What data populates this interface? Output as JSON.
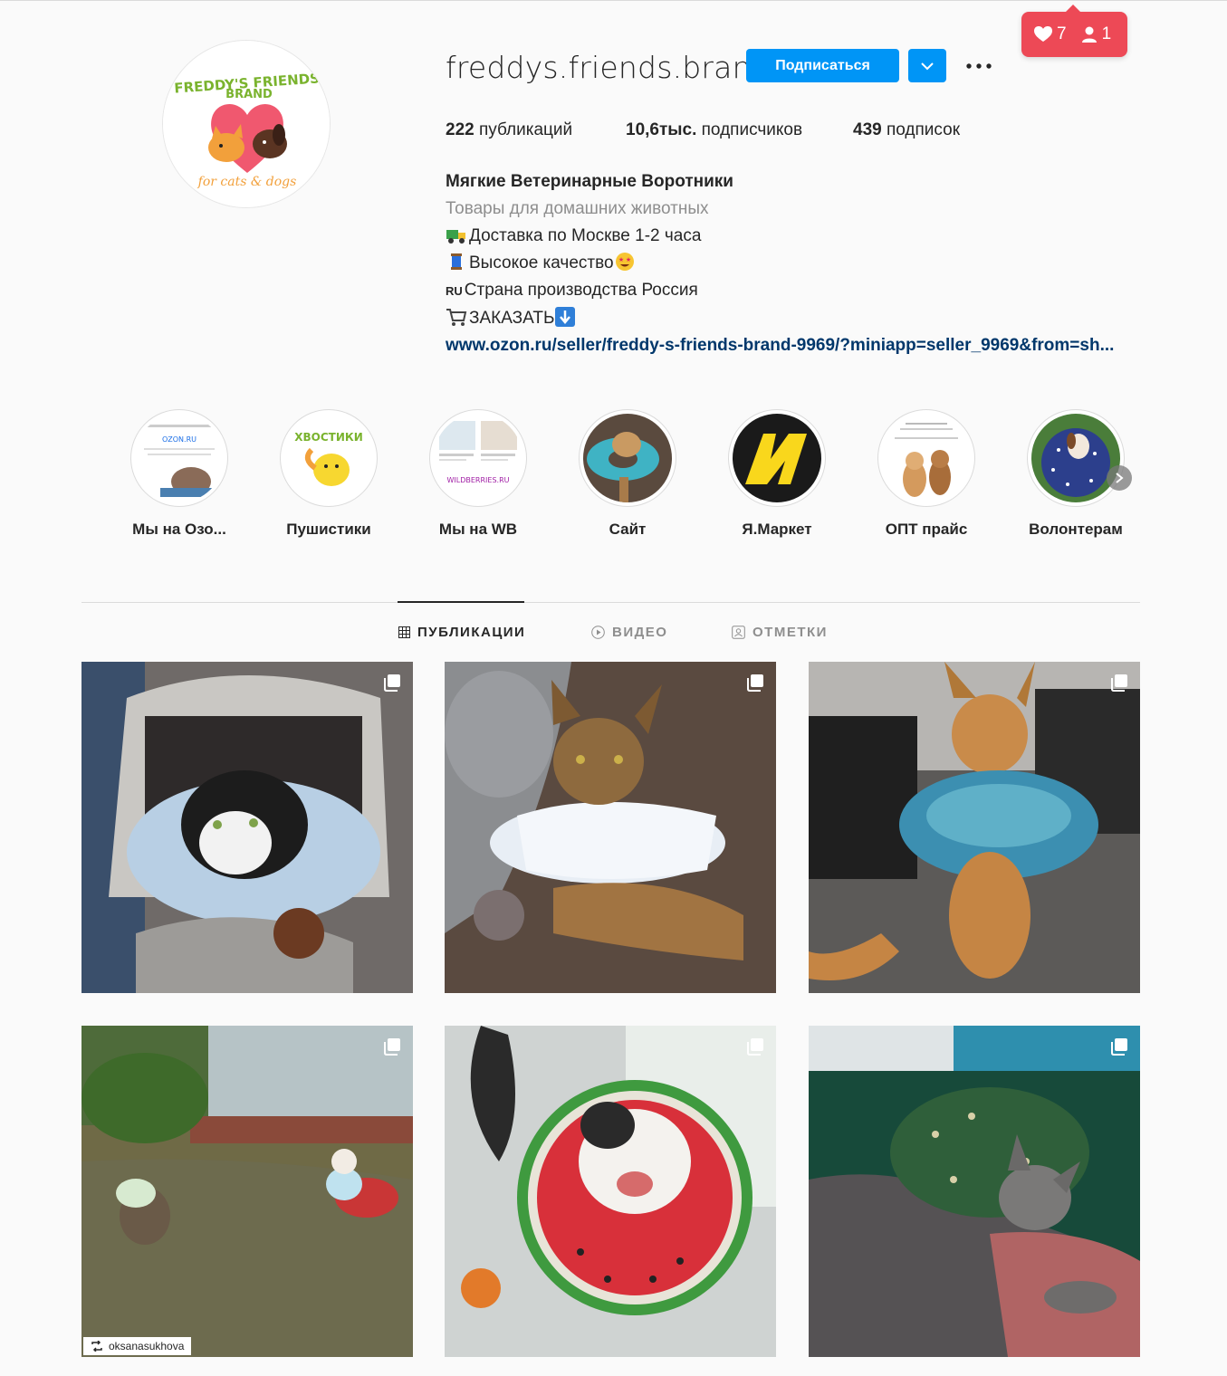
{
  "profile": {
    "username": "freddys.friends.brand",
    "follow_label": "Подписаться",
    "avatar": {
      "title": "FREDDY'S FRIENDS",
      "subtitle": "BRAND",
      "tagline": "for cats & dogs"
    }
  },
  "notifications": {
    "likes": "7",
    "followers": "1"
  },
  "stats": {
    "posts_count": "222",
    "posts_label": " публикаций",
    "followers_count": "10,6тыс.",
    "followers_label": " подписчиков",
    "following_count": "439",
    "following_label": " подписок"
  },
  "bio": {
    "name": "Мягкие Ветеринарные Воротники",
    "category": "Товары для домашних животных",
    "line1": "Доставка по Москве 1-2 часа",
    "line2": "Высокое качество",
    "line3_tag": "RU",
    "line3": "Страна производства Россия",
    "line4": "ЗАКАЗАТЬ",
    "link": "www.ozon.ru/seller/freddy-s-friends-brand-9969/?miniapp=seller_9969&from=sh..."
  },
  "highlights": [
    {
      "label": "Мы на Озо..."
    },
    {
      "label": "Пушистики"
    },
    {
      "label": "Мы на WB"
    },
    {
      "label": "Сайт"
    },
    {
      "label": "Я.Маркет"
    },
    {
      "label": "ОПТ прайс"
    },
    {
      "label": "Волонтерам"
    }
  ],
  "highlight_texts": {
    "ozon": "OZON.RU",
    "pushistiki": "ХВОСТИКИ",
    "wb": "WILDBERRIES.RU"
  },
  "tabs": [
    {
      "label": "ПУБЛИКАЦИИ",
      "active": true
    },
    {
      "label": "ВИДЕО",
      "active": false
    },
    {
      "label": "ОТМЕТКИ",
      "active": false
    }
  ],
  "posts": [
    {
      "id": "cat-in-carrier"
    },
    {
      "id": "cat-with-plush"
    },
    {
      "id": "maine-coon"
    },
    {
      "id": "garden-cats",
      "repost_user": "oksanasukhova"
    },
    {
      "id": "watermelon-collar"
    },
    {
      "id": "green-collar"
    }
  ],
  "colors": {
    "accent": "#0095f6",
    "notif": "#ed4956",
    "link": "#00376b"
  }
}
